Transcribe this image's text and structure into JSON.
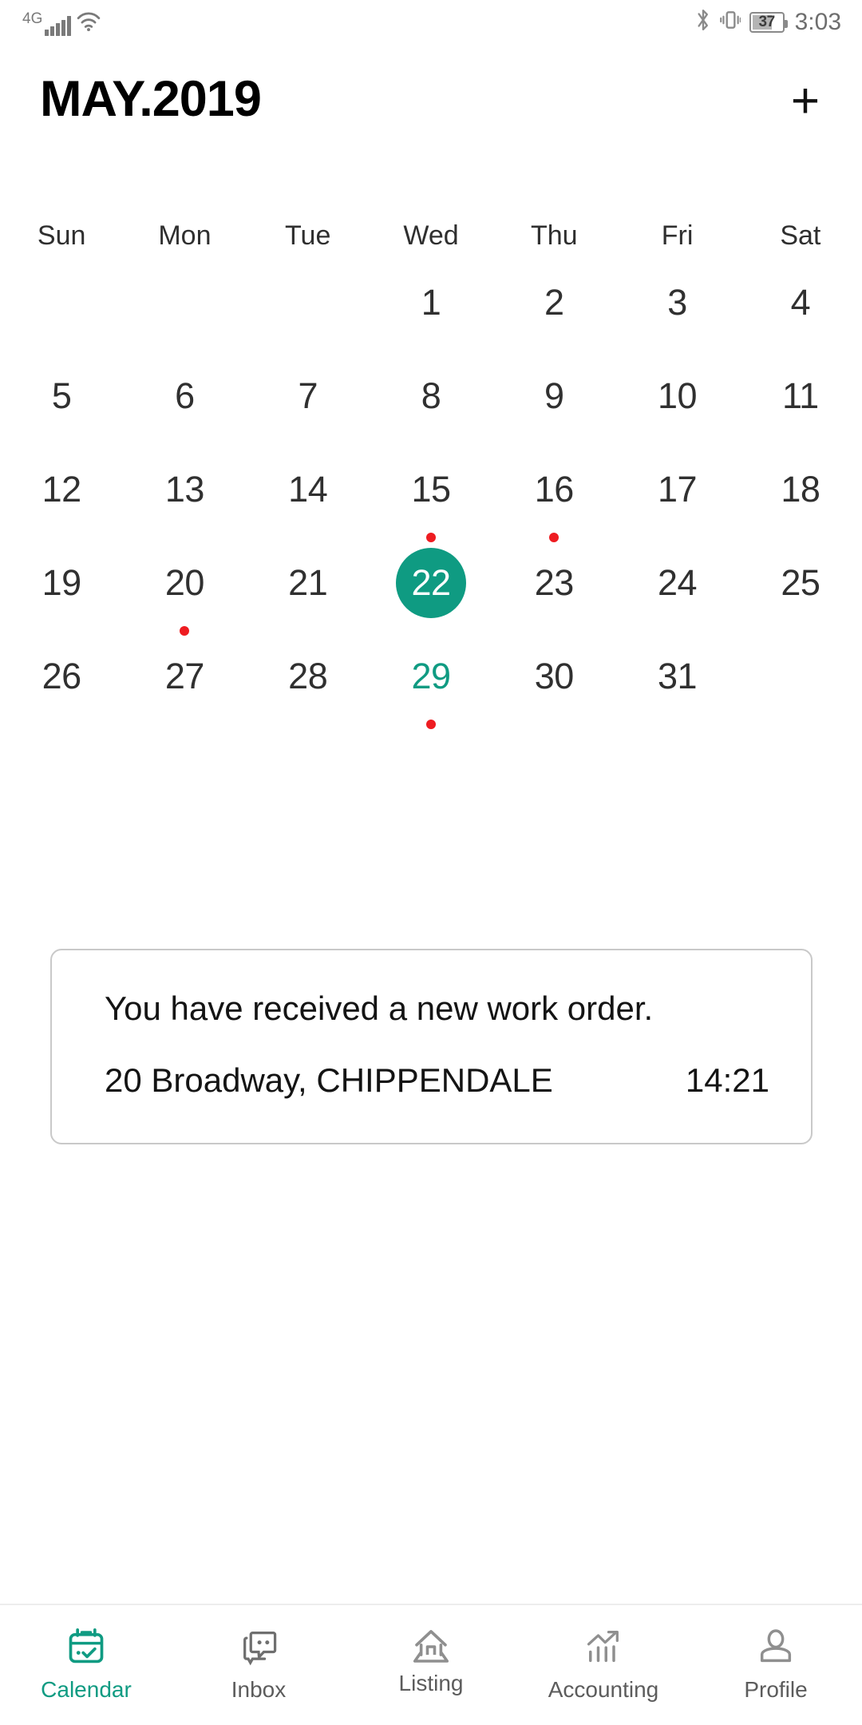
{
  "status_bar": {
    "network_label": "4G",
    "signal_icon": "signal-bars-icon",
    "wifi_icon": "wifi-icon",
    "bluetooth_icon": "bluetooth-icon",
    "vibrate_icon": "vibrate-icon",
    "battery_icon": "battery-icon",
    "battery_level": "37",
    "clock": "3:03"
  },
  "header": {
    "title": "MAY.2019",
    "add_label": "+",
    "add_icon": "plus-icon"
  },
  "calendar": {
    "weekdays": [
      "Sun",
      "Mon",
      "Tue",
      "Wed",
      "Thu",
      "Fri",
      "Sat"
    ],
    "selected_day": 22,
    "today": 29,
    "event_days": [
      15,
      16,
      20,
      29
    ],
    "accent_color": "#0f9b82",
    "event_dot_color": "#ee1c21",
    "weeks": [
      [
        {
          "day": "",
          "empty": true
        },
        {
          "day": "",
          "empty": true
        },
        {
          "day": "",
          "empty": true
        },
        {
          "day": "1"
        },
        {
          "day": "2"
        },
        {
          "day": "3"
        },
        {
          "day": "4"
        }
      ],
      [
        {
          "day": "5"
        },
        {
          "day": "6"
        },
        {
          "day": "7"
        },
        {
          "day": "8"
        },
        {
          "day": "9"
        },
        {
          "day": "10"
        },
        {
          "day": "11"
        }
      ],
      [
        {
          "day": "12"
        },
        {
          "day": "13"
        },
        {
          "day": "14"
        },
        {
          "day": "15",
          "dot": true
        },
        {
          "day": "16",
          "dot": true
        },
        {
          "day": "17"
        },
        {
          "day": "18"
        }
      ],
      [
        {
          "day": "19"
        },
        {
          "day": "20",
          "dot": true
        },
        {
          "day": "21"
        },
        {
          "day": "22",
          "selected": true
        },
        {
          "day": "23"
        },
        {
          "day": "24"
        },
        {
          "day": "25"
        }
      ],
      [
        {
          "day": "26"
        },
        {
          "day": "27"
        },
        {
          "day": "28"
        },
        {
          "day": "29",
          "today": true,
          "dot": true
        },
        {
          "day": "30"
        },
        {
          "day": "31"
        },
        {
          "day": "",
          "empty": true
        }
      ]
    ]
  },
  "notification": {
    "title": "You have received a new work order.",
    "address": "20 Broadway, CHIPPENDALE",
    "time": "14:21"
  },
  "bottom_nav": {
    "items": [
      {
        "label": "Calendar",
        "icon": "calendar-check-icon",
        "active": true
      },
      {
        "label": "Inbox",
        "icon": "chat-bubbles-icon",
        "active": false
      },
      {
        "label": "Listing",
        "icon": "house-icon",
        "active": false
      },
      {
        "label": "Accounting",
        "icon": "bar-chart-trend-icon",
        "active": false
      },
      {
        "label": "Profile",
        "icon": "person-icon",
        "active": false
      }
    ]
  }
}
